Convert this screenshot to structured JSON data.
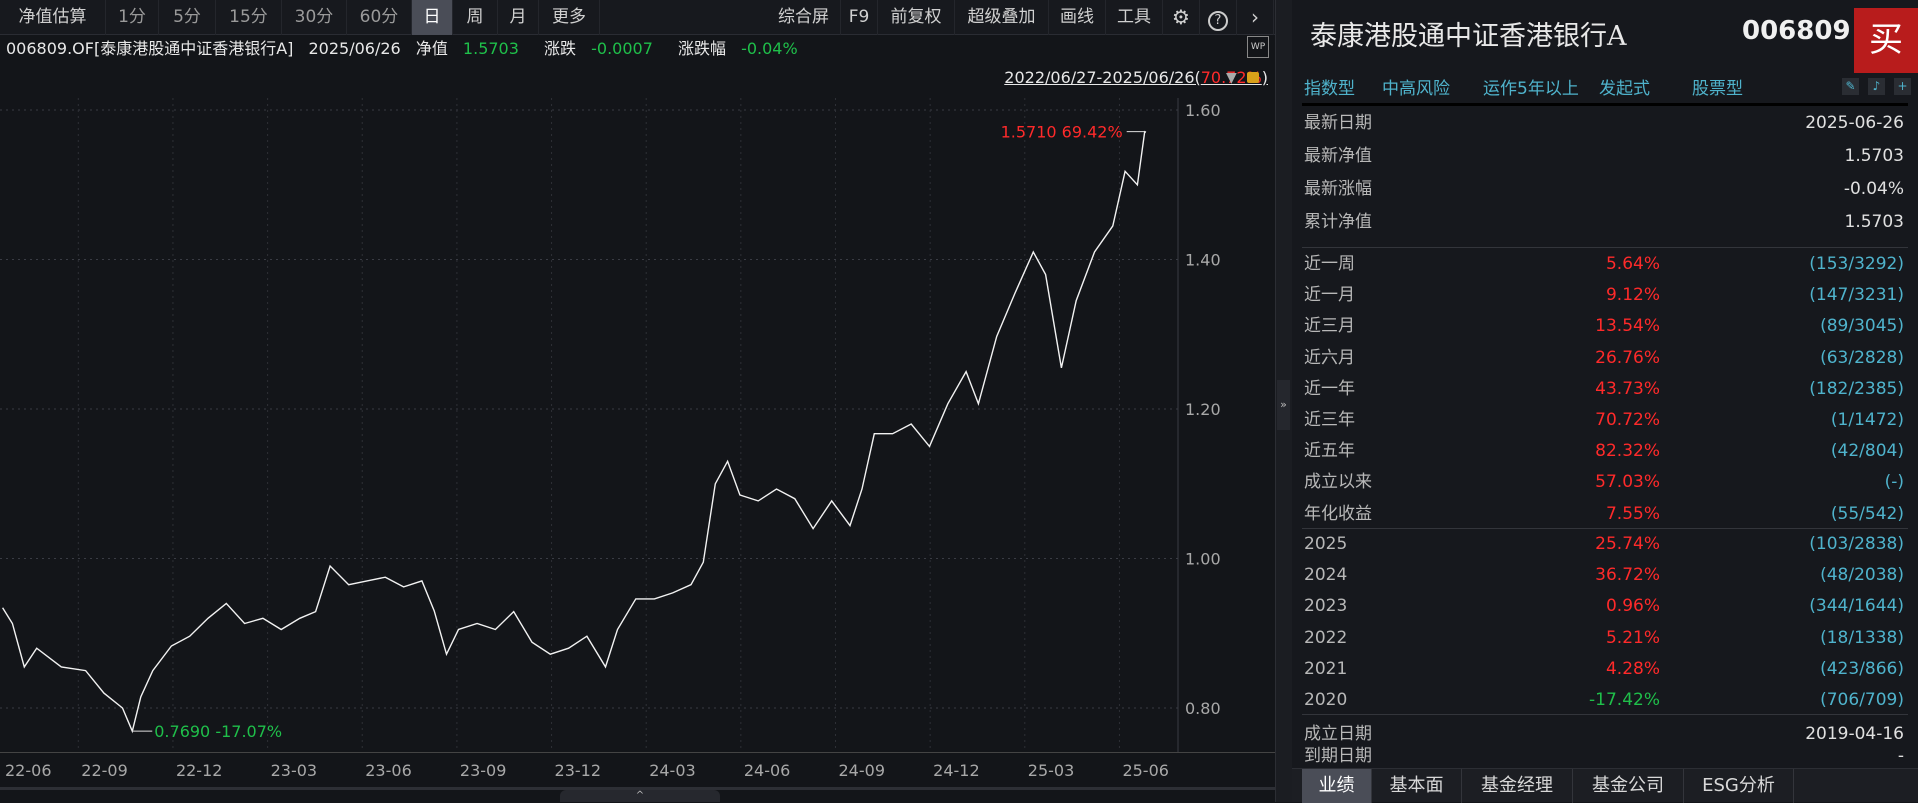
{
  "toolbar": {
    "left": [
      "净值估算",
      "1分",
      "5分",
      "15分",
      "30分",
      "60分",
      "日",
      "周",
      "月",
      "更多"
    ],
    "active": "日",
    "right": [
      "综合屏",
      "F9",
      "前复权",
      "超级叠加",
      "画线",
      "工具"
    ],
    "settings_icon": "gear-icon",
    "help_icon": "help-icon",
    "next_icon": "chevron-right-icon"
  },
  "info": {
    "name": "006809.OF[泰康港股通中证香港银行A]",
    "date": "2025/06/26",
    "nav_label": "净值",
    "nav": "1.5703",
    "chg_label": "涨跌",
    "chg": "-0.0007",
    "chg_pct_label": "涨跌幅",
    "chg_pct": "-0.04%"
  },
  "range": {
    "text": "2022/06/27-2025/06/26(",
    "pct": "70.72%",
    "close": ")"
  },
  "colors": {
    "up": "#ff2a2a",
    "down": "#1fbf4a",
    "accent": "#4fb3cc",
    "buy": "#b81c1c"
  },
  "chart_data": {
    "type": "line",
    "title": "006809.OF 单位净值",
    "x_unit": "months since 2022-06-01",
    "ylim": [
      0.72,
      1.65
    ],
    "yticks": [
      {
        "v": 1.6,
        "label": "1.60"
      },
      {
        "v": 1.4,
        "label": "1.40"
      },
      {
        "v": 1.2,
        "label": "1.20"
      },
      {
        "v": 1.0,
        "label": "1.00"
      },
      {
        "v": 0.8,
        "label": "0.80"
      }
    ],
    "xticks": [
      {
        "m": 0,
        "label": "22-06"
      },
      {
        "m": 3,
        "label": "22-09"
      },
      {
        "m": 6,
        "label": "22-12"
      },
      {
        "m": 9,
        "label": "23-03"
      },
      {
        "m": 12,
        "label": "23-06"
      },
      {
        "m": 15,
        "label": "23-09"
      },
      {
        "m": 18,
        "label": "23-12"
      },
      {
        "m": 21,
        "label": "24-03"
      },
      {
        "m": 24,
        "label": "24-06"
      },
      {
        "m": 27,
        "label": "24-09"
      },
      {
        "m": 30,
        "label": "24-12"
      },
      {
        "m": 33,
        "label": "25-03"
      },
      {
        "m": 36,
        "label": "25-06"
      }
    ],
    "points": [
      [
        0.6,
        0.934
      ],
      [
        0.91,
        0.913
      ],
      [
        1.29,
        0.855
      ],
      [
        1.68,
        0.88
      ],
      [
        2.46,
        0.855
      ],
      [
        3.23,
        0.85
      ],
      [
        3.81,
        0.82
      ],
      [
        4.4,
        0.8
      ],
      [
        4.71,
        0.769
      ],
      [
        4.98,
        0.815
      ],
      [
        5.36,
        0.85
      ],
      [
        5.95,
        0.883
      ],
      [
        6.53,
        0.896
      ],
      [
        7.11,
        0.92
      ],
      [
        7.69,
        0.94
      ],
      [
        8.27,
        0.913
      ],
      [
        8.85,
        0.92
      ],
      [
        9.43,
        0.905
      ],
      [
        10.02,
        0.92
      ],
      [
        10.52,
        0.929
      ],
      [
        10.98,
        0.99
      ],
      [
        11.57,
        0.965
      ],
      [
        12.15,
        0.97
      ],
      [
        12.73,
        0.975
      ],
      [
        13.31,
        0.962
      ],
      [
        13.89,
        0.97
      ],
      [
        14.28,
        0.93
      ],
      [
        14.67,
        0.872
      ],
      [
        15.05,
        0.905
      ],
      [
        15.64,
        0.913
      ],
      [
        16.22,
        0.905
      ],
      [
        16.8,
        0.929
      ],
      [
        17.38,
        0.888
      ],
      [
        17.96,
        0.872
      ],
      [
        18.54,
        0.88
      ],
      [
        19.12,
        0.896
      ],
      [
        19.71,
        0.855
      ],
      [
        20.09,
        0.905
      ],
      [
        20.67,
        0.946
      ],
      [
        21.26,
        0.946
      ],
      [
        21.84,
        0.954
      ],
      [
        22.42,
        0.965
      ],
      [
        22.81,
        0.995
      ],
      [
        23.19,
        1.1
      ],
      [
        23.58,
        1.13
      ],
      [
        23.97,
        1.085
      ],
      [
        24.55,
        1.077
      ],
      [
        25.13,
        1.093
      ],
      [
        25.71,
        1.08
      ],
      [
        26.29,
        1.04
      ],
      [
        26.88,
        1.077
      ],
      [
        27.46,
        1.044
      ],
      [
        27.84,
        1.093
      ],
      [
        28.23,
        1.167
      ],
      [
        28.81,
        1.167
      ],
      [
        29.4,
        1.18
      ],
      [
        29.98,
        1.15
      ],
      [
        30.56,
        1.207
      ],
      [
        31.14,
        1.25
      ],
      [
        31.53,
        1.207
      ],
      [
        32.11,
        1.297
      ],
      [
        32.69,
        1.355
      ],
      [
        33.27,
        1.41
      ],
      [
        33.66,
        1.38
      ],
      [
        34.16,
        1.255
      ],
      [
        34.63,
        1.345
      ],
      [
        35.21,
        1.41
      ],
      [
        35.79,
        1.445
      ],
      [
        36.18,
        1.518
      ],
      [
        36.57,
        1.5
      ],
      [
        36.8,
        1.571
      ],
      [
        36.84,
        1.5703
      ]
    ],
    "max_annotation": {
      "m": 36.8,
      "v": 1.571,
      "label": "1.5710 69.42%"
    },
    "min_annotation": {
      "m": 4.71,
      "v": 0.769,
      "label": "0.7690 -17.07%"
    }
  },
  "panel": {
    "title": "泰康港股通中证香港银行A",
    "code": "006809",
    "buy": "买",
    "tags": [
      "指数型",
      "中高风险",
      "运作5年以上",
      "发起式",
      "股票型"
    ],
    "basic": [
      {
        "label": "最新日期",
        "value": "2025-06-26",
        "color": "n"
      },
      {
        "label": "最新净值",
        "value": "1.5703",
        "color": "g"
      },
      {
        "label": "最新涨幅",
        "value": "-0.04%",
        "color": "g"
      },
      {
        "label": "累计净值",
        "value": "1.5703",
        "color": "n"
      }
    ],
    "periods": [
      {
        "label": "近一周",
        "pct": "5.64%",
        "rank": "(153/3292)"
      },
      {
        "label": "近一月",
        "pct": "9.12%",
        "rank": "(147/3231)"
      },
      {
        "label": "近三月",
        "pct": "13.54%",
        "rank": "(89/3045)"
      },
      {
        "label": "近六月",
        "pct": "26.76%",
        "rank": "(63/2828)"
      },
      {
        "label": "近一年",
        "pct": "43.73%",
        "rank": "(182/2385)"
      },
      {
        "label": "近三年",
        "pct": "70.72%",
        "rank": "(1/1472)"
      },
      {
        "label": "近五年",
        "pct": "82.32%",
        "rank": "(42/804)"
      },
      {
        "label": "成立以来",
        "pct": "57.03%",
        "rank": "(-)"
      },
      {
        "label": "年化收益",
        "pct": "7.55%",
        "rank": "(55/542)"
      }
    ],
    "years": [
      {
        "label": "2025",
        "pct": "25.74%",
        "rank": "(103/2838)"
      },
      {
        "label": "2024",
        "pct": "36.72%",
        "rank": "(48/2038)"
      },
      {
        "label": "2023",
        "pct": "0.96%",
        "rank": "(344/1644)"
      },
      {
        "label": "2022",
        "pct": "5.21%",
        "rank": "(18/1338)"
      },
      {
        "label": "2021",
        "pct": "4.28%",
        "rank": "(423/866)"
      },
      {
        "label": "2020",
        "pct": "-17.42%",
        "rank": "(706/709)"
      }
    ],
    "dates": [
      {
        "label": "成立日期",
        "value": "2019-04-16"
      },
      {
        "label": "到期日期",
        "value": "-"
      }
    ],
    "tabs": [
      "业绩",
      "基本面",
      "基金经理",
      "基金公司",
      "ESG分析"
    ],
    "active_tab": "业绩"
  }
}
